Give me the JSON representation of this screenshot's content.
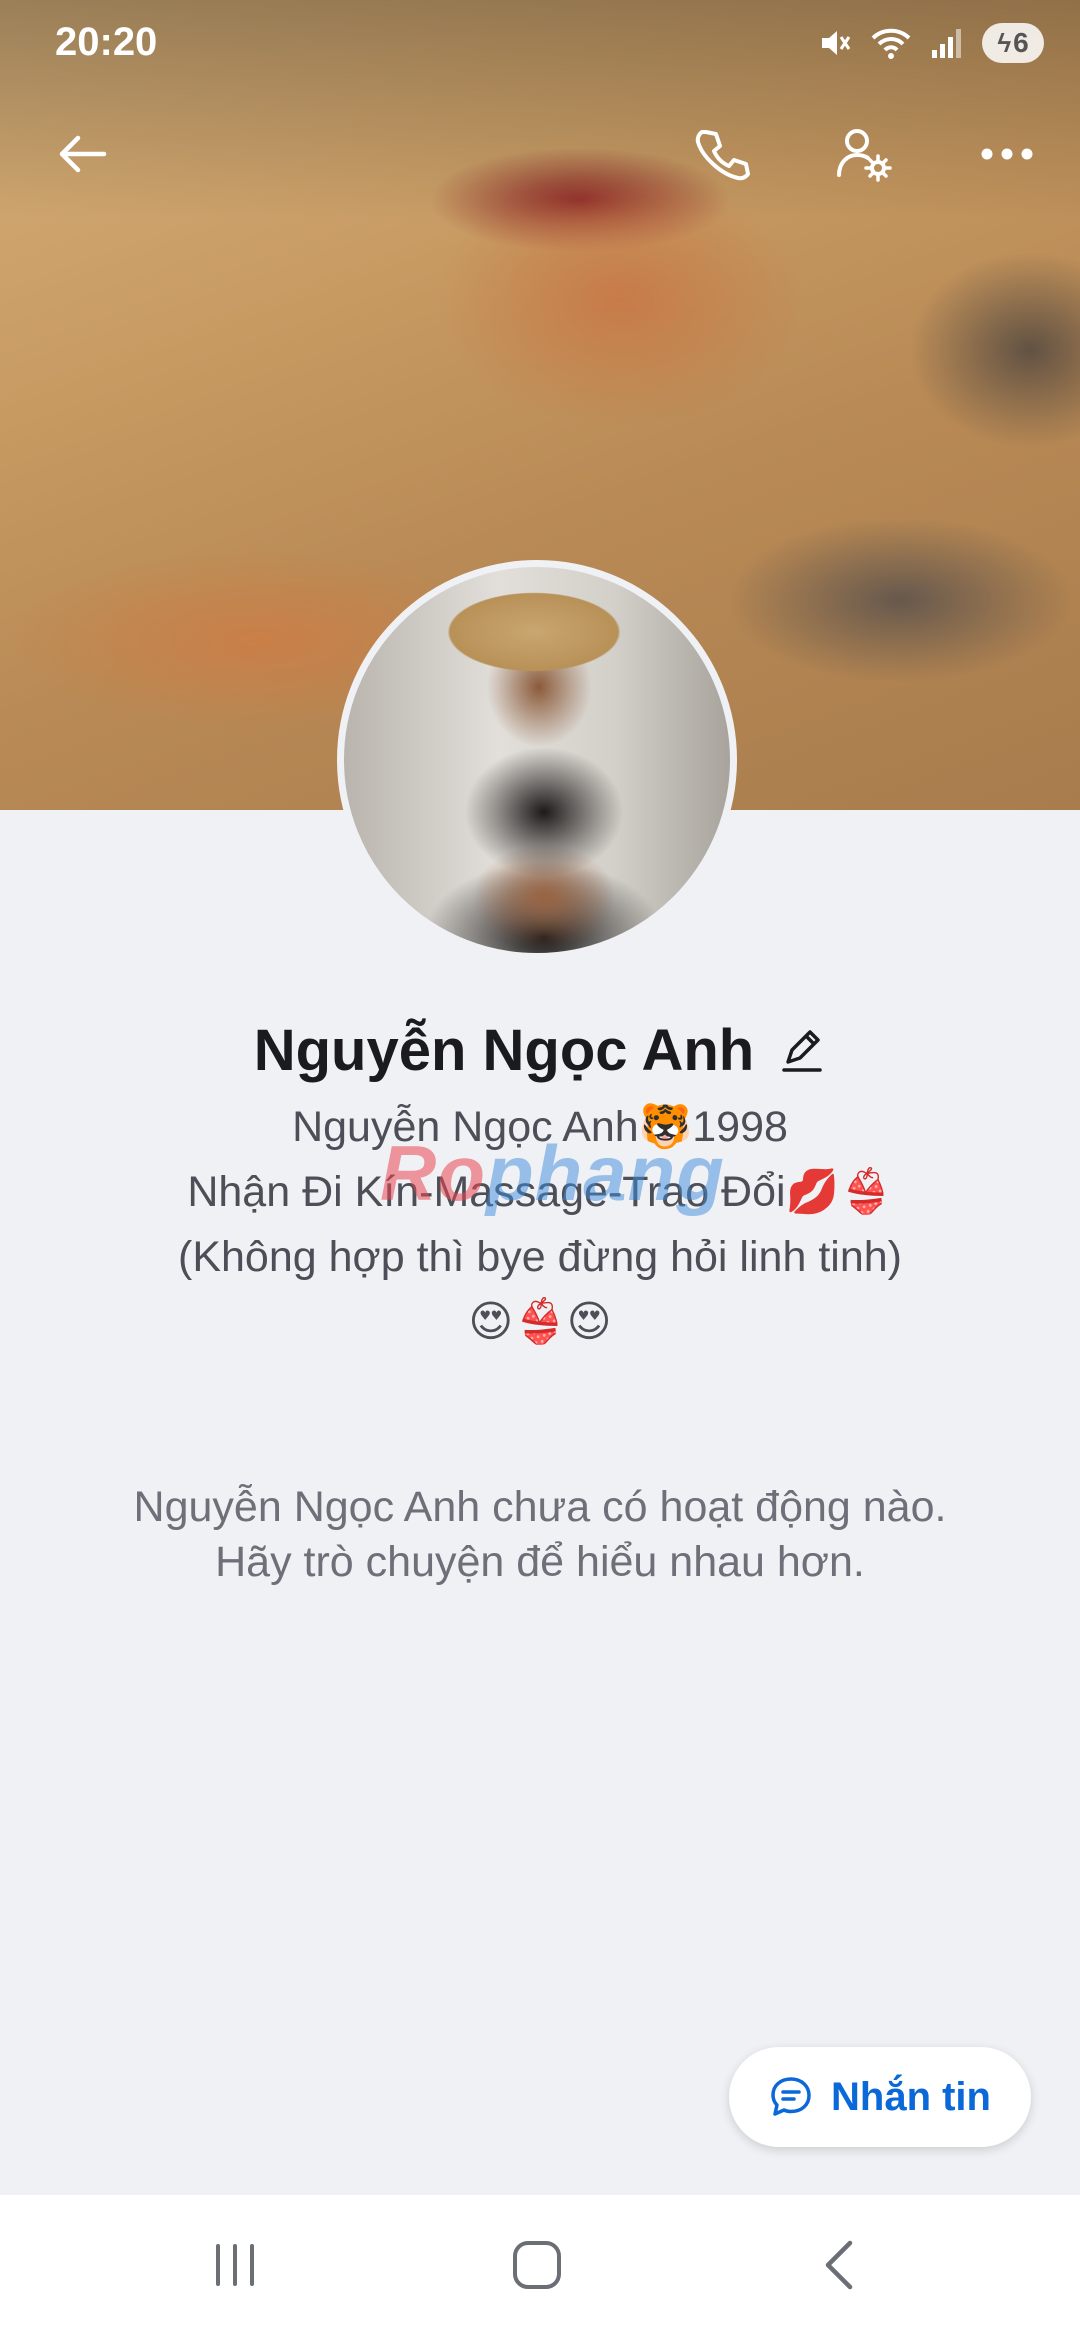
{
  "status_bar": {
    "time": "20:20",
    "battery_level": "6"
  },
  "top_bar": {
    "icons": [
      "back-arrow-icon",
      "phone-icon",
      "user-settings-icon",
      "more-icon"
    ]
  },
  "profile": {
    "name": "Nguyễn Ngọc Anh",
    "bio_lines": [
      "Nguyễn Ngọc Anh🐯1998",
      "Nhận Đi Kín-Massage-Trao Đổi💋👙",
      "(Không hợp thì bye đừng hỏi linh tinh)",
      "😍👙😍"
    ],
    "empty_activity": "Nguyễn Ngọc Anh chưa có hoạt động nào. Hãy trò chuyện để hiểu nhau hơn."
  },
  "watermark": {
    "part1": "Ro",
    "part2": "phang"
  },
  "message_button": {
    "label": "Nhắn tin"
  },
  "nav_bar": {
    "icons": [
      "recent-apps-icon",
      "home-icon",
      "back-icon"
    ]
  },
  "colors": {
    "accent": "#0a68d8",
    "background": "#f0f1f5"
  }
}
